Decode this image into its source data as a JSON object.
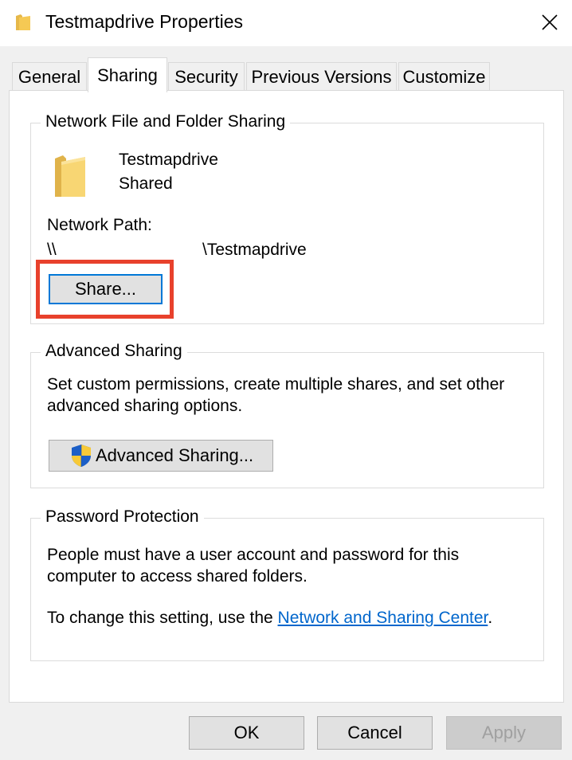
{
  "window": {
    "title": "Testmapdrive Properties",
    "icon": "folder-icon",
    "close_icon": "close-icon"
  },
  "tabs": [
    {
      "label": "General",
      "active": false
    },
    {
      "label": "Sharing",
      "active": true
    },
    {
      "label": "Security",
      "active": false
    },
    {
      "label": "Previous Versions",
      "active": false
    },
    {
      "label": "Customize",
      "active": false
    }
  ],
  "network_sharing": {
    "legend": "Network File and Folder Sharing",
    "folder_name": "Testmapdrive",
    "status": "Shared",
    "path_label": "Network Path:",
    "path_prefix": "\\\\",
    "path_suffix": "\\Testmapdrive",
    "share_button": "Share..."
  },
  "advanced_sharing": {
    "legend": "Advanced Sharing",
    "description_line1": "Set custom permissions, create multiple shares, and set other",
    "description_line2": "advanced sharing options.",
    "button": "Advanced Sharing...",
    "button_icon": "uac-shield-icon"
  },
  "password_protection": {
    "legend": "Password Protection",
    "line1": "People must have a user account and password for this",
    "line2": "computer to access shared folders.",
    "line3_prefix": "To change this setting, use the ",
    "link": "Network and Sharing Center",
    "line3_suffix": "."
  },
  "footer": {
    "ok": "OK",
    "cancel": "Cancel",
    "apply": "Apply"
  },
  "colors": {
    "highlight": "#e8412c",
    "focus_border": "#0078d7",
    "link": "#0066cc",
    "folder": "#f5c954"
  }
}
